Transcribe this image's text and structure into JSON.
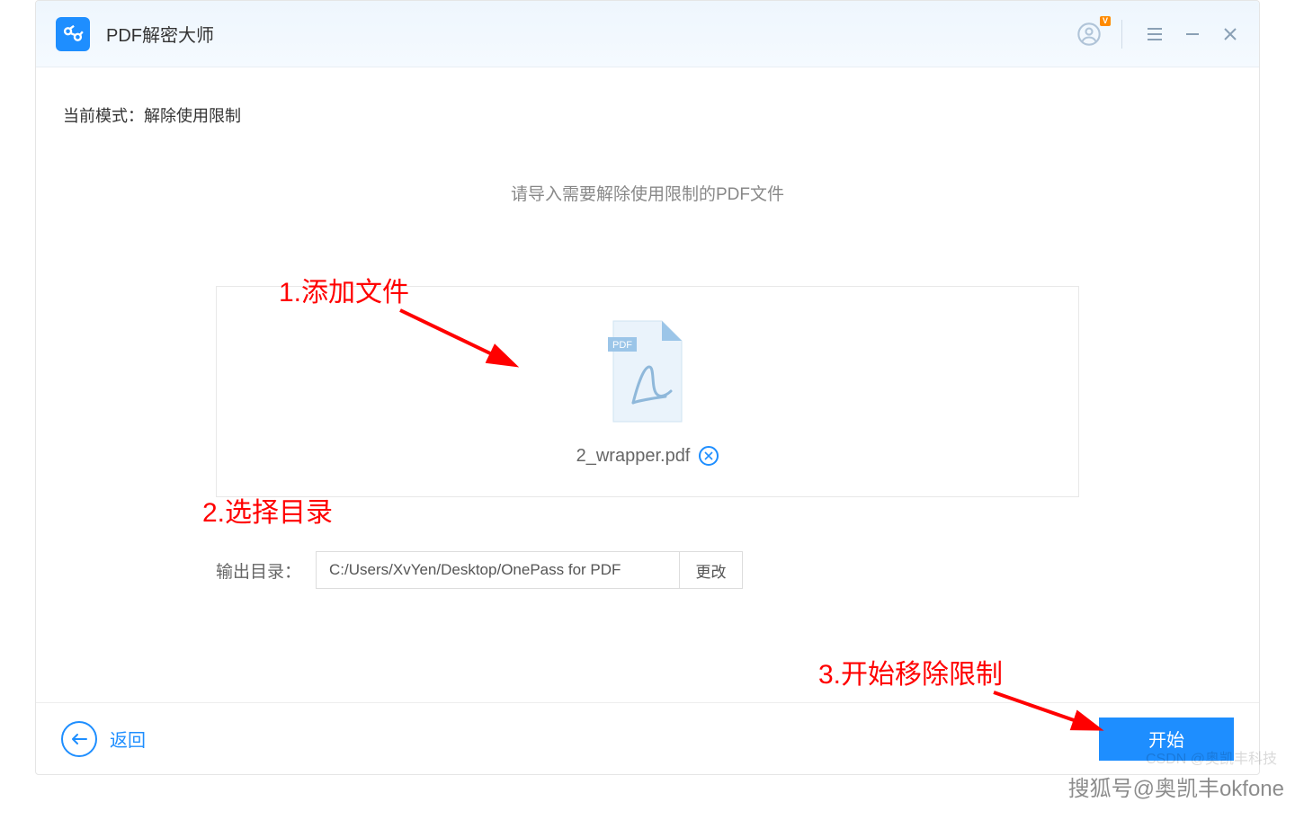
{
  "titlebar": {
    "app_name": "PDF解密大师",
    "vip_badge": "V"
  },
  "main": {
    "mode_label": "当前模式：",
    "mode_value": "解除使用限制",
    "instruction": "请导入需要解除使用限制的PDF文件",
    "pdf_badge": "PDF",
    "file_name": "2_wrapper.pdf",
    "output_label": "输出目录：",
    "output_path": "C:/Users/XvYen/Desktop/OnePass for PDF",
    "change_label": "更改"
  },
  "annotations": {
    "step1": "1.添加文件",
    "step2": "2.选择目录",
    "step3": "3.开始移除限制"
  },
  "bottom": {
    "back_label": "返回",
    "start_label": "开始"
  },
  "watermark": "搜狐号@奥凯丰okfone",
  "watermark2": "CSDN @奥凯丰科技"
}
